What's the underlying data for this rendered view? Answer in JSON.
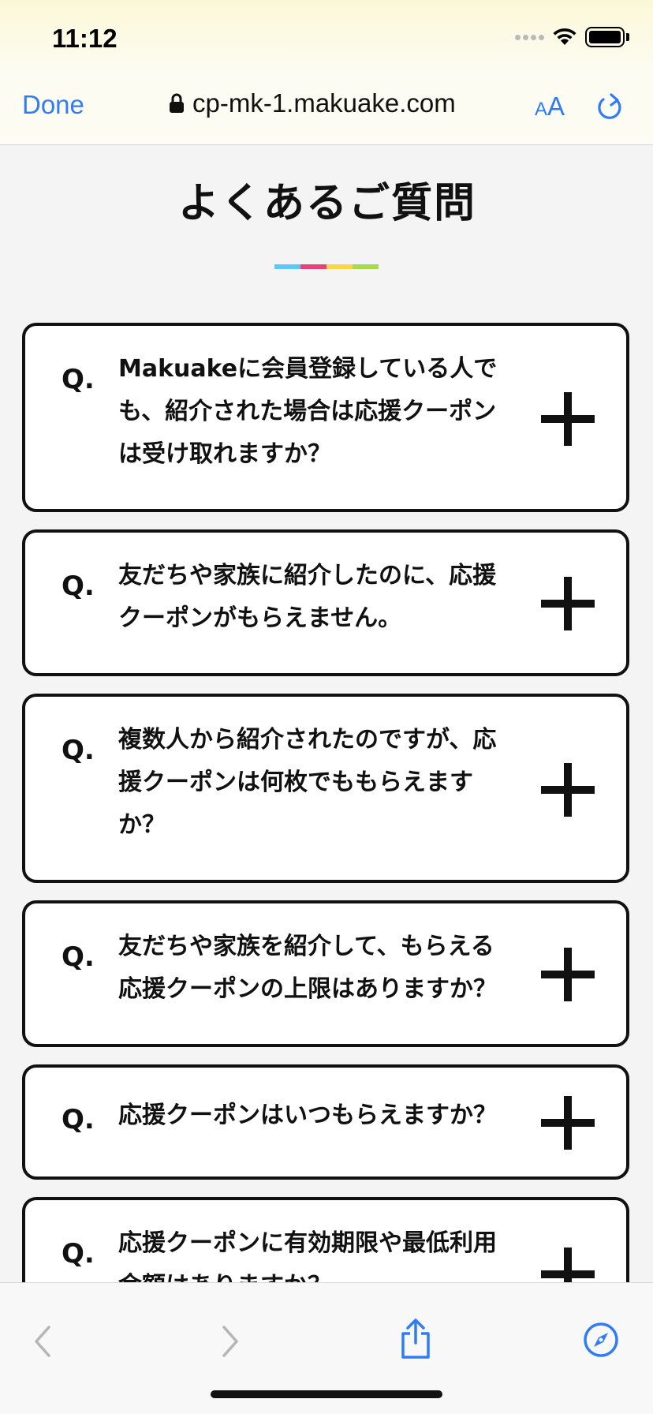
{
  "status": {
    "time": "11:12"
  },
  "nav": {
    "done_label": "Done",
    "url": "cp-mk-1.makuake.com",
    "aa_small": "A",
    "aa_big": "A"
  },
  "page": {
    "title": "よくあるご質問",
    "underline_colors": [
      "#5bc8f5",
      "#e8417a",
      "#f5d84a",
      "#a7d94b"
    ]
  },
  "faq": {
    "q_marker": "Q.",
    "items": [
      {
        "question": "Makuakeに会員登録している人でも、紹介された場合は応援クーポンは受け取れますか？"
      },
      {
        "question": "友だちや家族に紹介したのに、応援クーポンがもらえません。"
      },
      {
        "question": "複数人から紹介されたのですが、応援クーポンは何枚でももらえますか？"
      },
      {
        "question": "友だちや家族を紹介して、もらえる応援クーポンの上限はありますか？"
      },
      {
        "question": "応援クーポンはいつもらえますか？"
      },
      {
        "question": "応援クーポンに有効期限や最低利用金額はありますか？"
      }
    ]
  },
  "colors": {
    "accent": "#2f7cf6",
    "toolbar_disabled": "#b5b5b5"
  }
}
